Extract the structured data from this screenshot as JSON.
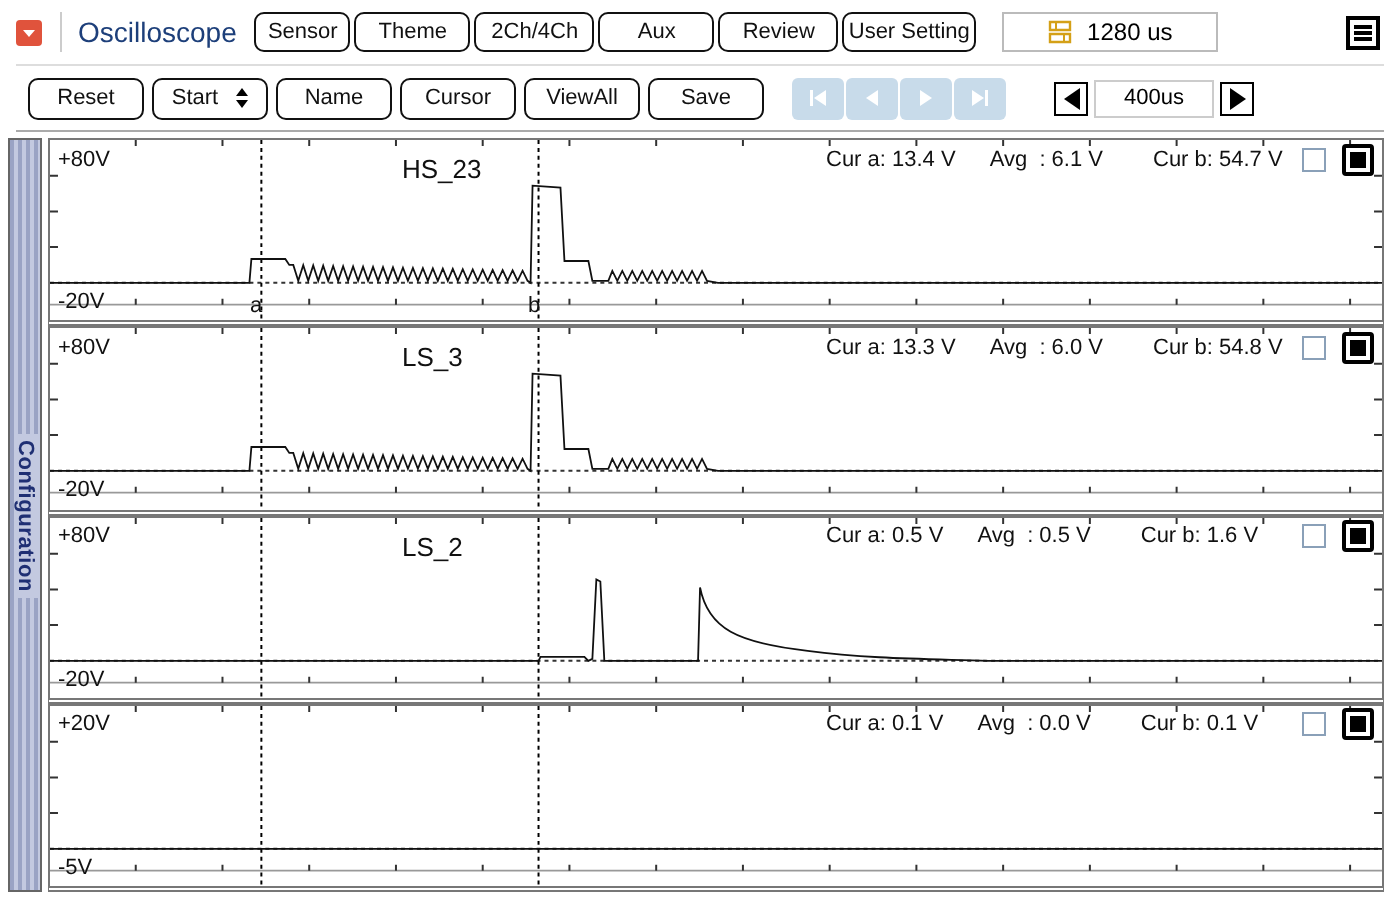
{
  "header": {
    "title": "Oscilloscope",
    "buttons": [
      "Sensor",
      "Theme",
      "2Ch/4Ch",
      "Aux",
      "Review",
      "User Setting"
    ],
    "time_window": "1280 us"
  },
  "toolbar": {
    "buttons": [
      {
        "label": "Reset",
        "kind": "button"
      },
      {
        "label": "Start",
        "kind": "select"
      },
      {
        "label": "Name",
        "kind": "button"
      },
      {
        "label": "Cursor",
        "kind": "button"
      },
      {
        "label": "ViewAll",
        "kind": "button"
      },
      {
        "label": "Save",
        "kind": "button"
      }
    ],
    "playback": [
      {
        "kind": "first",
        "disabled": true
      },
      {
        "kind": "prev",
        "disabled": true
      },
      {
        "kind": "next",
        "disabled": true
      },
      {
        "kind": "last",
        "disabled": true
      }
    ],
    "timebase": "400us"
  },
  "sidebar": {
    "label": "Configuration"
  },
  "channels": [
    {
      "name": "HS_23",
      "top": "+80V",
      "bottom": "-20V",
      "cur_a": "Cur a: 13.4 V",
      "avg": "Avg  : 6.1 V",
      "cur_b": "Cur b: 54.7 V",
      "kind": "switching",
      "cursor_labels": [
        "a",
        "b"
      ],
      "toggles": [
        {
          "kind": "checkbox",
          "checked": false
        },
        {
          "kind": "toggle",
          "checked": true
        }
      ]
    },
    {
      "name": "LS_3",
      "top": "+80V",
      "bottom": "-20V",
      "cur_a": "Cur a: 13.3 V",
      "avg": "Avg  : 6.0 V",
      "cur_b": "Cur b: 54.8 V",
      "kind": "switching",
      "toggles": [
        {
          "kind": "checkbox",
          "checked": false
        },
        {
          "kind": "toggle",
          "checked": true
        }
      ]
    },
    {
      "name": "LS_2",
      "top": "+80V",
      "bottom": "-20V",
      "cur_a": "Cur a: 0.5 V",
      "avg": "Avg  : 0.5 V",
      "cur_b": "Cur b: 1.6 V",
      "kind": "spike",
      "toggles": [
        {
          "kind": "checkbox",
          "checked": false
        },
        {
          "kind": "toggle",
          "checked": true
        }
      ]
    },
    {
      "top": "+20V",
      "bottom": "-5V",
      "cur_a": "Cur a: 0.1 V",
      "avg": "Avg  : 0.0 V",
      "cur_b": "Cur b: 0.1 V",
      "kind": "flat",
      "toggles": [
        {
          "kind": "checkbox",
          "checked": false
        },
        {
          "kind": "toggle",
          "checked": true
        }
      ]
    }
  ]
}
